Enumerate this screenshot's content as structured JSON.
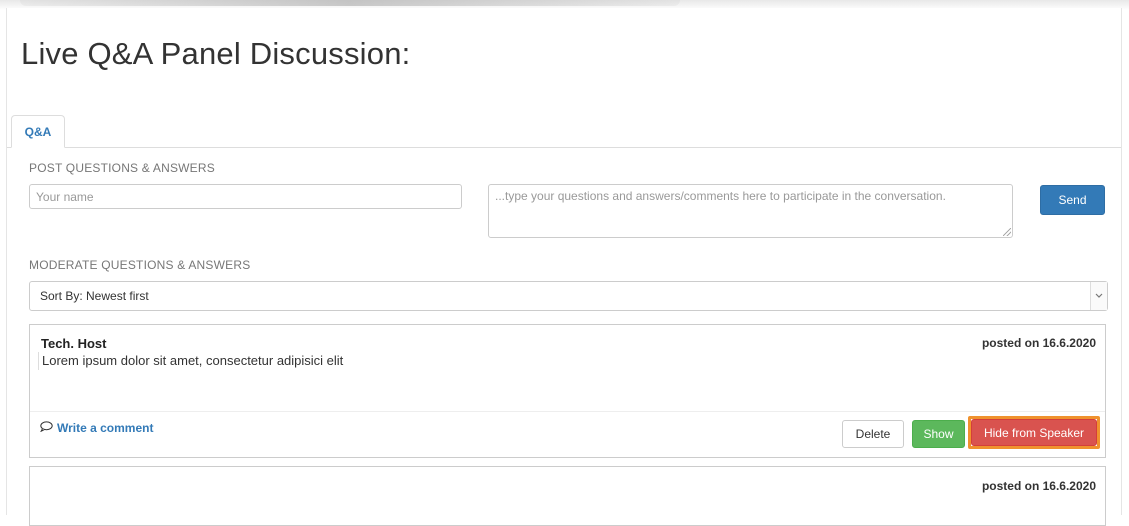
{
  "page": {
    "title": "Live Q&A Panel Discussion:"
  },
  "tabs": [
    {
      "label": "Q&A",
      "active": true
    }
  ],
  "post": {
    "heading": "POST QUESTIONS & ANSWERS",
    "name_placeholder": "Your name",
    "name_value": "",
    "message_placeholder": "...type your questions and answers/comments here to participate in the conversation.",
    "message_value": "",
    "send_label": "Send"
  },
  "moderate": {
    "heading": "MODERATE QUESTIONS & ANSWERS",
    "sort_selected": "Sort By: Newest first"
  },
  "posts": [
    {
      "author": "Tech. Host",
      "date": "posted on 16.6.2020",
      "body": "Lorem ipsum dolor sit amet, consectetur adipisici elit",
      "comment_link": "Write a comment",
      "delete_label": "Delete",
      "show_label": "Show",
      "hide_label": "Hide from Speaker"
    },
    {
      "author": "",
      "date": "posted on 16.6.2020",
      "body": ""
    }
  ],
  "colors": {
    "primary": "#337ab7",
    "success": "#5cb85c",
    "danger": "#d9534f",
    "highlight": "#f0922e"
  },
  "icons": {
    "comment": "speech-bubble-icon",
    "select_arrow": "chevron-down-icon"
  }
}
